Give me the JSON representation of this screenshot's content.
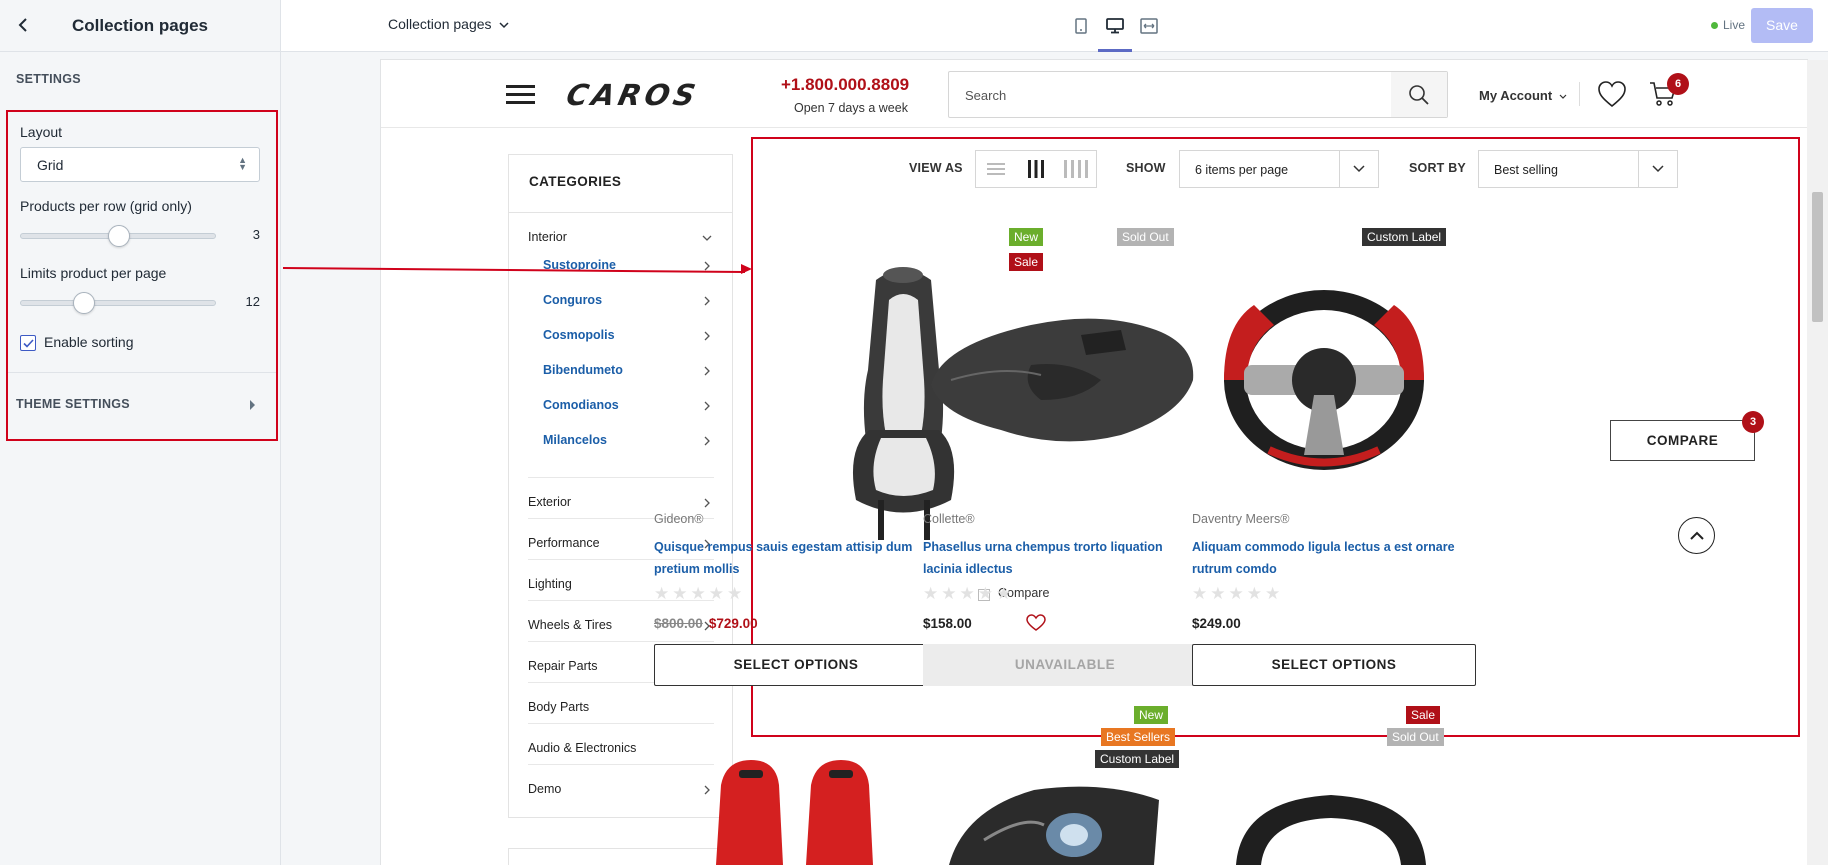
{
  "editor": {
    "title": "Collection pages",
    "settings_heading": "SETTINGS",
    "layout_label": "Layout",
    "layout_value": "Grid",
    "products_per_row_label": "Products per row (grid only)",
    "products_per_row_value": "3",
    "limits_label": "Limits product per page",
    "limits_value": "12",
    "enable_sorting_label": "Enable sorting",
    "enable_sorting_checked": true,
    "theme_settings_label": "THEME SETTINGS",
    "highlight_color": "#d0021b"
  },
  "topbar": {
    "page_select": "Collection pages",
    "devices": [
      "mobile-icon",
      "desktop-icon",
      "full-width-icon"
    ],
    "active_device": "desktop-icon",
    "live_label": "Live",
    "save_label": "Save"
  },
  "store": {
    "logo": "CAROS",
    "phone": "+1.800.000.8809",
    "hours": "Open 7 days a week",
    "search_placeholder": "Search",
    "account_label": "My Account",
    "cart_count": "6",
    "brand_color": "#b01018"
  },
  "categories": {
    "title": "CATEGORIES",
    "interior": {
      "label": "Interior",
      "children": [
        "Sustoproine",
        "Conguros",
        "Cosmopolis",
        "Bibendumeto",
        "Comodianos",
        "Milancelos"
      ]
    },
    "items": [
      {
        "label": "Exterior",
        "has_children": true
      },
      {
        "label": "Performance",
        "has_children": true
      },
      {
        "label": "Lighting",
        "has_children": false
      },
      {
        "label": "Wheels & Tires",
        "has_children": true
      },
      {
        "label": "Repair Parts",
        "has_children": false
      },
      {
        "label": "Body Parts",
        "has_children": false
      },
      {
        "label": "Audio & Electronics",
        "has_children": false
      },
      {
        "label": "Demo",
        "has_children": true
      }
    ]
  },
  "toolbar": {
    "view_as_label": "VIEW AS",
    "view_modes": [
      "list-view-icon",
      "grid-3-icon",
      "grid-4-icon"
    ],
    "active_view": "grid-3-icon",
    "show_label": "SHOW",
    "show_value": "6 items per page",
    "sort_label": "SORT BY",
    "sort_value": "Best selling"
  },
  "products": [
    {
      "badges": [
        {
          "text": "New",
          "color": "#6bae2c"
        },
        {
          "text": "Sale",
          "color": "#b01018"
        }
      ],
      "vendor": "Gideon®",
      "title": "Quisque rempus sauis egestam attisip dum pretium mollis",
      "compare_label": "Compare",
      "old_price": "$800.00",
      "price": "$729.00",
      "button": "SELECT OPTIONS",
      "available": true,
      "image": "racing-seat"
    },
    {
      "badges": [
        {
          "text": "Sold Out",
          "color": "#b3b3b3"
        }
      ],
      "vendor": "Collette®",
      "title": "Phasellus urna chempus trorto liquation lacinia idlectus",
      "price": "$158.00",
      "button": "UNAVAILABLE",
      "available": false,
      "image": "car-hood"
    },
    {
      "badges": [
        {
          "text": "Custom Label",
          "color": "#333333"
        }
      ],
      "vendor": "Daventry Meers®",
      "title": "Aliquam commodo ligula lectus a est ornare rutrum comdo",
      "price": "$249.00",
      "button": "SELECT OPTIONS",
      "available": true,
      "image": "steering-wheel"
    }
  ],
  "compare_float": {
    "label": "COMPARE",
    "count": "3"
  },
  "second_row_badges": [
    [],
    [
      {
        "text": "New",
        "color": "#6bae2c"
      },
      {
        "text": "Best Sellers",
        "color": "#e87722"
      },
      {
        "text": "Custom Label",
        "color": "#333333"
      }
    ],
    [
      {
        "text": "Sale",
        "color": "#b01018"
      },
      {
        "text": "Sold Out",
        "color": "#b3b3b3"
      }
    ]
  ]
}
